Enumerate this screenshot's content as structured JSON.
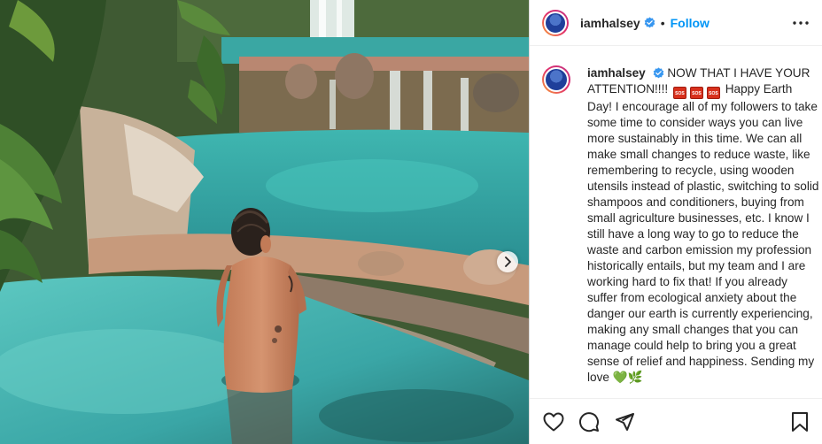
{
  "post": {
    "username": "iamhalsey",
    "follow_label": "Follow",
    "separator": "•",
    "verified": true,
    "caption": {
      "part1": "NOW THAT I HAVE YOUR ATTENTION!!!!",
      "emoji": [
        "SOS",
        "SOS",
        "SOS"
      ],
      "part2": "Happy Earth Day! I encourage all of my followers to take some time to consider ways you can live more sustainably in this time. We can all make small changes to reduce waste, like remembering to recycle, using wooden utensils instead of plastic, switching to solid shampoos and conditioners, buying from small agriculture businesses, etc. I know I still have a long way to go to reduce the waste and carbon emission my profession historically entails, but my team and I are working hard to fix that! If you already suffer from ecological anxiety about the danger our earth is currently experiencing, making any small changes that you can manage could help to bring you a great sense of relief and happiness. Sending my love",
      "trailing_emoji": "💚🌿"
    }
  },
  "icons": {
    "verified": "verified-badge-icon",
    "more": "more-options-icon",
    "like": "heart-icon",
    "comment": "comment-icon",
    "share": "share-paper-plane-icon",
    "save": "bookmark-icon",
    "next": "chevron-right-icon"
  },
  "colors": {
    "link_blue": "#0095f6",
    "verified_blue": "#3897f0",
    "sos_red": "#d8301c"
  }
}
